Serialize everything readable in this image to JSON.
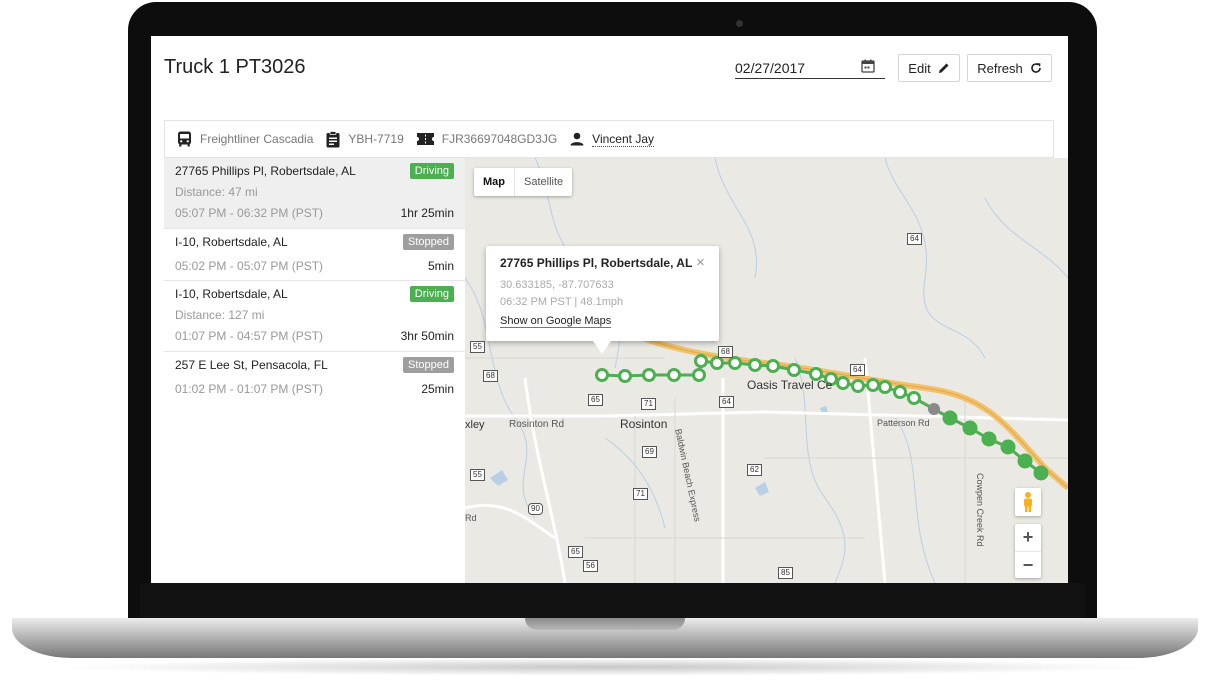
{
  "header": {
    "title": "Truck 1 PT3026",
    "date": "02/27/2017",
    "edit_label": "Edit",
    "refresh_label": "Refresh"
  },
  "vehicle": {
    "model": "Freightliner Cascadia",
    "plate": "YBH-7719",
    "vin": "FJR36697048GD3JG",
    "driver": "Vincent Jay"
  },
  "segments": [
    {
      "address": "27765 Phillips Pl, Robertsdale, AL",
      "status": "Driving",
      "distance": "Distance: 47 mi",
      "time": "05:07 PM - 06:32 PM (PST)",
      "duration": "1hr 25min"
    },
    {
      "address": "I-10, Robertsdale, AL",
      "status": "Stopped",
      "time": "05:02 PM - 05:07 PM (PST)",
      "duration": "5min"
    },
    {
      "address": "I-10, Robertsdale, AL",
      "status": "Driving",
      "distance": "Distance: 127 mi",
      "time": "01:07 PM - 04:57 PM (PST)",
      "duration": "3hr 50min"
    },
    {
      "address": "257 E Lee St, Pensacola, FL",
      "status": "Stopped",
      "time": "01:02 PM - 01:07 PM (PST)",
      "duration": "25min"
    }
  ],
  "map": {
    "type_map": "Map",
    "type_satellite": "Satellite",
    "zoom_in": "+",
    "zoom_out": "−",
    "popup": {
      "title": "27765 Phillips Pl, Robertsdale, AL",
      "close": "×",
      "coords": "30.633185, -87.707633",
      "detail": "06:32 PM PST | 48.1mph",
      "link": "Show on Google Maps"
    },
    "labels": {
      "rosinton": "Rosinton",
      "rosinton_rd": "Rosinton Rd",
      "oasis": "Oasis Travel Ce",
      "patterson": "Patterson Rd",
      "baldwin": "Baldwin Beach Express",
      "cowpen": "Cowpen Creek Rd",
      "loxley": "xley",
      "rd": "Rd"
    },
    "shields": [
      "64",
      "55",
      "68",
      "68",
      "65",
      "71",
      "64",
      "64",
      "69",
      "55",
      "62",
      "71",
      "90",
      "65",
      "56",
      "85"
    ],
    "colors": {
      "route": "#4caf50",
      "stop": "#8a8a8a",
      "highway": "#f2c26b"
    }
  }
}
